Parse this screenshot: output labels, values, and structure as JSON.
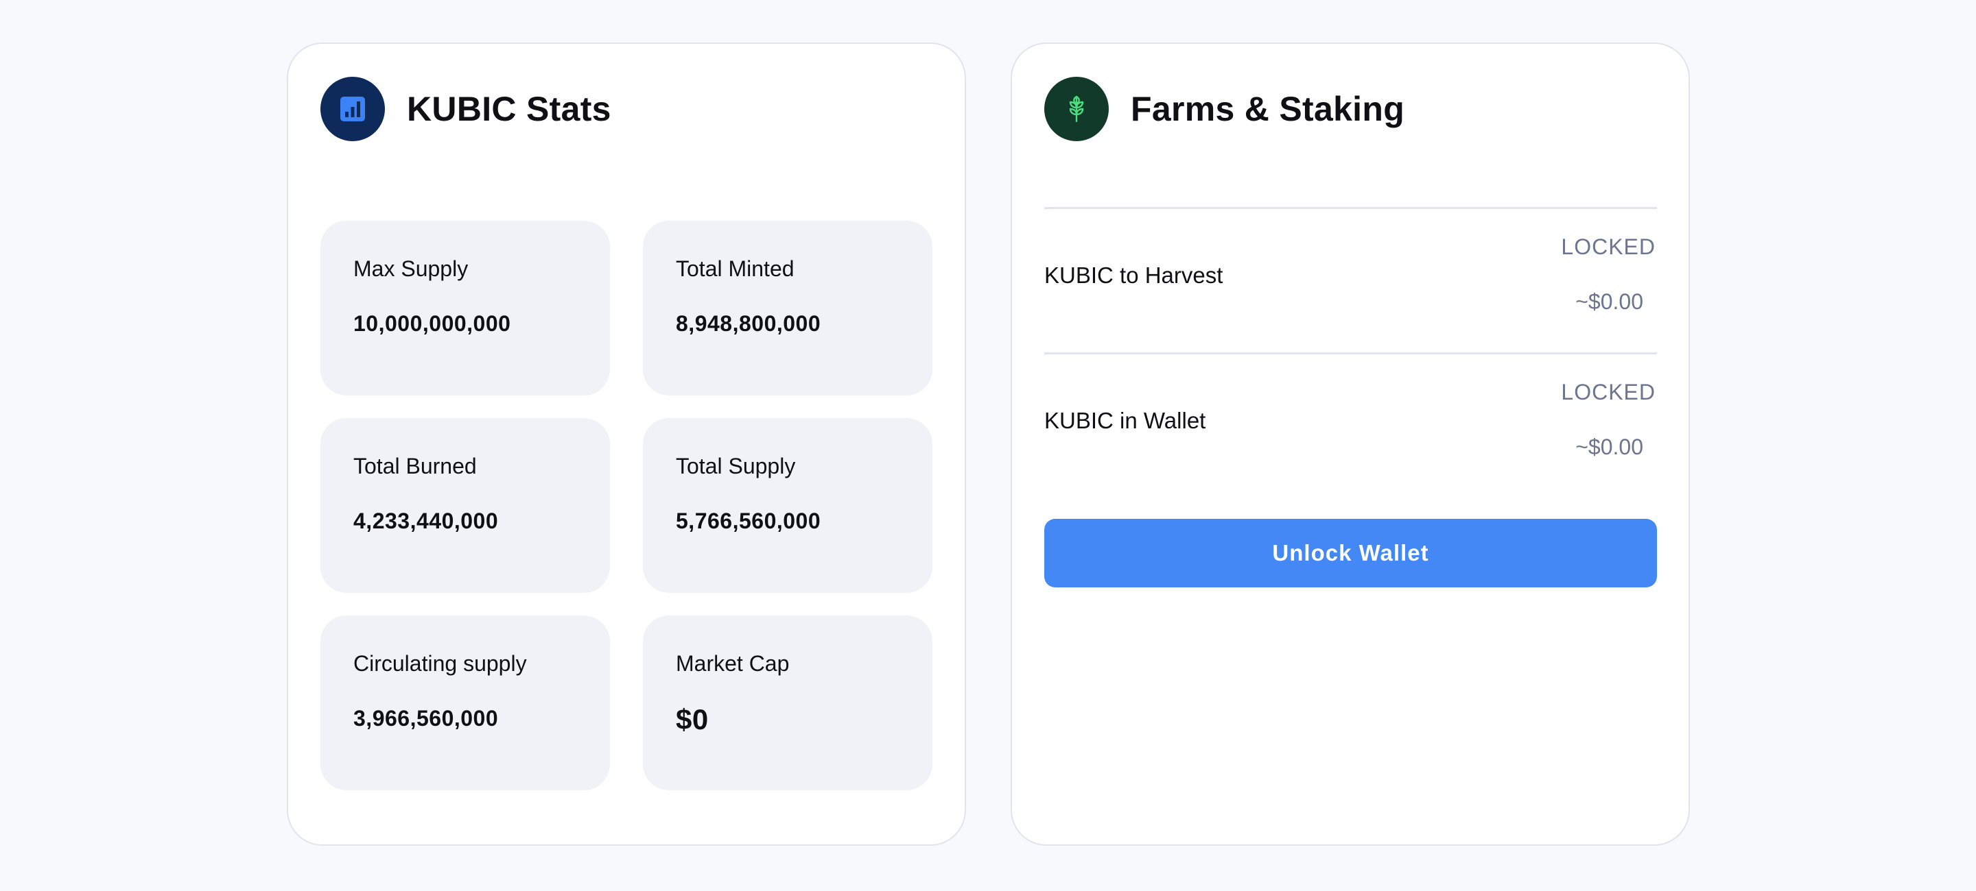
{
  "stats_card": {
    "title": "KUBIC Stats",
    "icon": "bar-chart-icon",
    "items": [
      {
        "label": "Max Supply",
        "value": "10,000,000,000"
      },
      {
        "label": "Total Minted",
        "value": "8,948,800,000"
      },
      {
        "label": "Total Burned",
        "value": "4,233,440,000"
      },
      {
        "label": "Total Supply",
        "value": "5,766,560,000"
      },
      {
        "label": "Circulating supply",
        "value": "3,966,560,000"
      },
      {
        "label": "Market Cap",
        "value": "$0"
      }
    ]
  },
  "farms_card": {
    "title": "Farms & Staking",
    "icon": "sprout-icon",
    "rows": [
      {
        "label": "KUBIC to Harvest",
        "status": "LOCKED",
        "usd": "~$0.00"
      },
      {
        "label": "KUBIC in Wallet",
        "status": "LOCKED",
        "usd": "~$0.00"
      }
    ],
    "button_label": "Unlock Wallet"
  },
  "colors": {
    "accent": "#4388f4",
    "stats_icon_bg": "#0d2a5a",
    "farms_icon_bg": "#123a2b",
    "muted_text": "#6c7590"
  }
}
